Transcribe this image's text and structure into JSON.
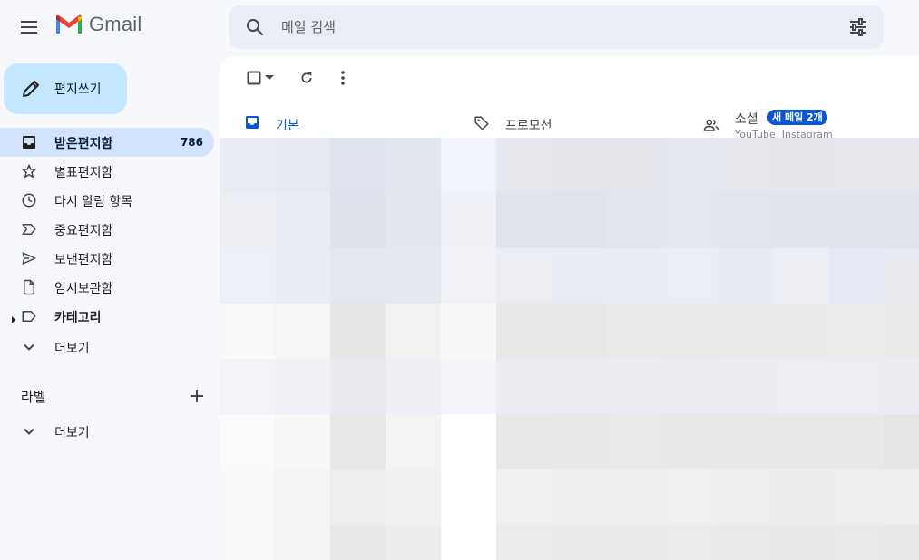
{
  "app": {
    "logo_text": "Gmail",
    "brand_colors": [
      "#ea4335",
      "#4285f4",
      "#34a853",
      "#fbbc04"
    ]
  },
  "topbar": {
    "menu_icon": "hamburger-menu-icon",
    "search_placeholder": "메일 검색",
    "search_icon": "search-icon",
    "filter_icon": "search-options-icon"
  },
  "compose": {
    "label": "편지쓰기",
    "icon": "pencil-icon"
  },
  "sidebar": {
    "items": [
      {
        "label": "받은편지함",
        "count": "786",
        "icon": "inbox-icon",
        "active": true
      },
      {
        "label": "별표편지함",
        "icon": "star-icon"
      },
      {
        "label": "다시 알림 항목",
        "icon": "clock-icon"
      },
      {
        "label": "중요편지함",
        "icon": "important-icon"
      },
      {
        "label": "보낸편지함",
        "icon": "send-icon"
      },
      {
        "label": "임시보관함",
        "icon": "draft-icon"
      },
      {
        "label": "카테고리",
        "icon": "label-icon",
        "bold": true
      },
      {
        "label": "더보기",
        "icon": "chevron-down-icon"
      }
    ],
    "labels_title": "라벨",
    "labels_more": "더보기"
  },
  "toolbar": {
    "select_icon": "checkbox-icon",
    "select_dropdown_icon": "caret-down-icon",
    "refresh_icon": "refresh-icon",
    "more_icon": "more-vert-icon"
  },
  "tabs": [
    {
      "label": "기본",
      "icon": "inbox-icon",
      "active": true
    },
    {
      "label": "프로모션",
      "icon": "tag-icon"
    },
    {
      "label": "소셜",
      "icon": "people-icon",
      "badge": "새 메일 2개",
      "subtitle": "YouTube, Instagram"
    }
  ],
  "colors": {
    "accent": "#0b57d0",
    "compose_bg": "#c2e7ff",
    "active_nav_bg": "#d3e3fd",
    "search_bg": "#e9eef6",
    "page_bg": "#f6f8fc"
  },
  "email_list": {
    "redacted": true,
    "mosaic_rows": [
      [
        "#e9ecf3",
        "#e6e9f1",
        "#dfe3ed",
        "#e2e6ef",
        "#f0f3fa",
        "#e6e8ee",
        "#e3e5eb",
        "#e3e5eb",
        "#e4e7ee",
        "#e5e7ed",
        "#e4e6ec",
        "#e5e7ec",
        "#e6e8ed"
      ],
      [
        "#eceef4",
        "#e9ecf3",
        "#dfe2eb",
        "#e3e6ee",
        "#eef0f6",
        "#e0e3ec",
        "#e0e3ec",
        "#e3e5ed",
        "#e4e7ee",
        "#e2e5ee",
        "#e1e4ec",
        "#e0e3ec",
        "#e0e3ec"
      ],
      [
        "#eceff5",
        "#e9ecf3",
        "#e5e7ee",
        "#e6e8ef",
        "#f0f2f7",
        "#ebedf2",
        "#e8ebf3",
        "#e9ecf4",
        "#eaedf3",
        "#e7eaf2",
        "#eceef3",
        "#e6e9f3",
        "#e8eaef"
      ],
      [
        "#f9f9f9",
        "#f5f5f5",
        "#e6e6e5",
        "#f1f1f0",
        "#f8f8f8",
        "#e8e8e7",
        "#e8e8e7",
        "#eaeae9",
        "#e9e9e8",
        "#eaeae9",
        "#eaeae9",
        "#ececeb",
        "#eaeae9"
      ],
      [
        "#f2f3f7",
        "#eff0f5",
        "#e9eaf0",
        "#edeef3",
        "#f3f4f9",
        "#ebecf1",
        "#ebecf1",
        "#ebecf1",
        "#ebecf1",
        "#ebecf1",
        "#ecedf2",
        "#ecedf2",
        "#ebecf1"
      ],
      [
        "#fbfbfb",
        "#f7f7f7",
        "#e6e7e6",
        "#f3f3f3",
        "#ffffff",
        "#e6e7e6",
        "#e7e8e7",
        "#e9e9e9",
        "#e8e8e8",
        "#e7e8e7",
        "#e8e8e8",
        "#e8e8e8",
        "#e4e5e4"
      ],
      [
        "#f9f9f9",
        "#f4f4f4",
        "#ededed",
        "#f0f0f0",
        "#ffffff",
        "#efefef",
        "#eeeeee",
        "#eeeeee",
        "#efefef",
        "#ededed",
        "#ececec",
        "#ededed",
        "#eeeeee"
      ],
      [
        "#f9f9f9",
        "#f4f4f4",
        "#e7e8e7",
        "#ececec",
        "#ffffff",
        "#ebebeb",
        "#eaeaea",
        "#eaeaea",
        "#ebebeb",
        "#e9e9e9",
        "#e8e8e8",
        "#e9e9e9",
        "#e8e8e8"
      ]
    ]
  }
}
